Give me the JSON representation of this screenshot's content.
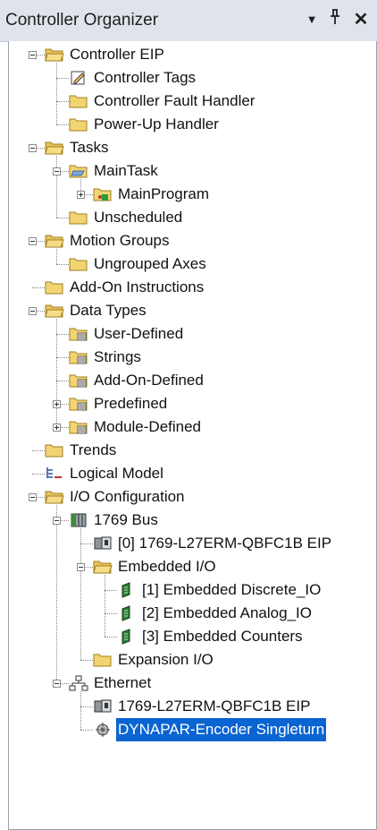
{
  "window": {
    "title": "Controller Organizer",
    "buttons": {
      "dropdown": "▼",
      "pin": "ꟷ",
      "close": "✕"
    }
  },
  "tree": [
    {
      "label": "Controller EIP",
      "icon": "folder-open-icon",
      "exp": "minus"
    },
    {
      "label": "Controller Tags",
      "icon": "tags-icon"
    },
    {
      "label": "Controller Fault Handler",
      "icon": "folder-icon"
    },
    {
      "label": "Power-Up Handler",
      "icon": "folder-icon"
    },
    {
      "label": "Tasks",
      "icon": "folder-open-icon",
      "exp": "minus"
    },
    {
      "label": "MainTask",
      "icon": "task-icon",
      "exp": "minus"
    },
    {
      "label": "MainProgram",
      "icon": "program-icon",
      "exp": "plus"
    },
    {
      "label": "Unscheduled",
      "icon": "folder-icon"
    },
    {
      "label": "Motion Groups",
      "icon": "folder-open-icon",
      "exp": "minus"
    },
    {
      "label": "Ungrouped Axes",
      "icon": "folder-icon"
    },
    {
      "label": "Add-On Instructions",
      "icon": "folder-icon"
    },
    {
      "label": "Data Types",
      "icon": "folder-open-icon",
      "exp": "minus"
    },
    {
      "label": "User-Defined",
      "icon": "datatype-folder-icon"
    },
    {
      "label": "Strings",
      "icon": "datatype-folder-icon"
    },
    {
      "label": "Add-On-Defined",
      "icon": "datatype-folder-icon"
    },
    {
      "label": "Predefined",
      "icon": "datatype-folder-icon",
      "exp": "plus"
    },
    {
      "label": "Module-Defined",
      "icon": "datatype-folder-icon",
      "exp": "plus"
    },
    {
      "label": "Trends",
      "icon": "folder-icon"
    },
    {
      "label": "Logical Model",
      "icon": "logical-model-icon"
    },
    {
      "label": "I/O Configuration",
      "icon": "folder-open-icon",
      "exp": "minus"
    },
    {
      "label": "1769 Bus",
      "icon": "bus-icon",
      "exp": "minus"
    },
    {
      "label": "[0] 1769-L27ERM-QBFC1B EIP",
      "icon": "controller-module-icon"
    },
    {
      "label": "Embedded I/O",
      "icon": "folder-open-icon",
      "exp": "minus"
    },
    {
      "label": "[1] Embedded Discrete_IO",
      "icon": "io-module-icon"
    },
    {
      "label": "[2] Embedded Analog_IO",
      "icon": "io-module-icon"
    },
    {
      "label": "[3] Embedded Counters",
      "icon": "io-module-icon"
    },
    {
      "label": "Expansion I/O",
      "icon": "folder-icon"
    },
    {
      "label": "Ethernet",
      "icon": "network-icon",
      "exp": "minus"
    },
    {
      "label": "1769-L27ERM-QBFC1B EIP",
      "icon": "controller-module-icon"
    },
    {
      "label": "DYNAPAR-Encoder Singleturn",
      "icon": "encoder-device-icon",
      "selected": true
    }
  ]
}
